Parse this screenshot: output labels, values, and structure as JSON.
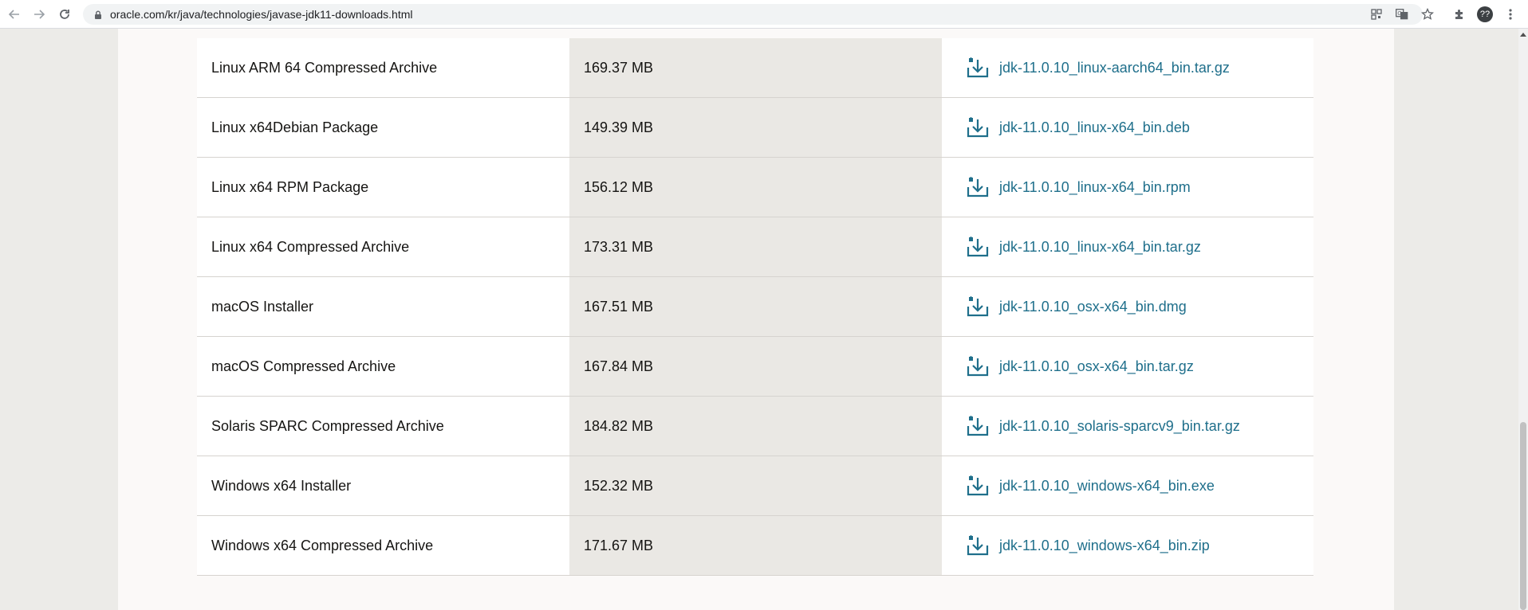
{
  "browser": {
    "url": "oracle.com/kr/java/technologies/javase-jdk11-downloads.html",
    "profile_label": "??"
  },
  "downloads": [
    {
      "name": "Linux ARM 64 Compressed Archive",
      "size": "169.37 MB",
      "file": "jdk-11.0.10_linux-aarch64_bin.tar.gz"
    },
    {
      "name": "Linux x64Debian Package",
      "size": "149.39 MB",
      "file": "jdk-11.0.10_linux-x64_bin.deb"
    },
    {
      "name": "Linux x64 RPM Package",
      "size": "156.12 MB",
      "file": "jdk-11.0.10_linux-x64_bin.rpm"
    },
    {
      "name": "Linux x64 Compressed Archive",
      "size": "173.31 MB",
      "file": "jdk-11.0.10_linux-x64_bin.tar.gz"
    },
    {
      "name": "macOS Installer",
      "size": "167.51 MB",
      "file": "jdk-11.0.10_osx-x64_bin.dmg"
    },
    {
      "name": "macOS Compressed Archive",
      "size": "167.84 MB",
      "file": "jdk-11.0.10_osx-x64_bin.tar.gz"
    },
    {
      "name": "Solaris SPARC Compressed Archive",
      "size": "184.82 MB",
      "file": "jdk-11.0.10_solaris-sparcv9_bin.tar.gz"
    },
    {
      "name": "Windows x64 Installer",
      "size": "152.32 MB",
      "file": "jdk-11.0.10_windows-x64_bin.exe"
    },
    {
      "name": "Windows x64 Compressed Archive",
      "size": "171.67 MB",
      "file": "jdk-11.0.10_windows-x64_bin.zip"
    }
  ],
  "colors": {
    "link": "#1f6f8b",
    "size_column_bg": "#eae8e4",
    "page_bg": "#ecebe8"
  }
}
